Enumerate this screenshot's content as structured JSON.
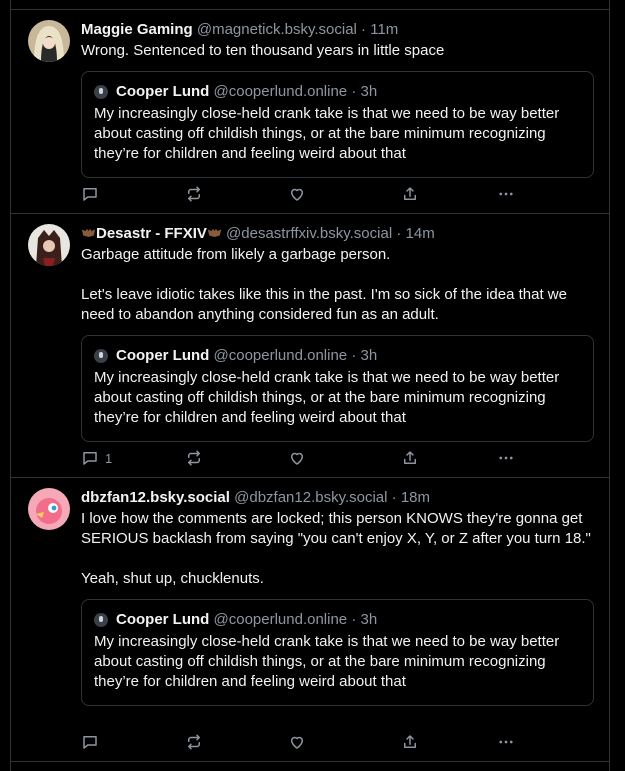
{
  "posts": [
    {
      "author": "Maggie Gaming",
      "handle": "@magnetick.bsky.social",
      "separator": "·",
      "time": "11m",
      "paragraphs": [
        "Wrong. Sentenced to ten thousand years in little space"
      ],
      "quote": {
        "author": "Cooper Lund",
        "handle": "@cooperlund.online",
        "separator": "·",
        "time": "3h",
        "text": "My increasingly close-held crank take is that we need to be way better about casting off childish things, or at the bare minimum recognizing they’re for children and feeling weird about that"
      },
      "reply_count": ""
    },
    {
      "author": "Desastr - FFXIV",
      "handle": "@desastrffxiv.bsky.social",
      "separator": "·",
      "time": "14m",
      "paragraphs": [
        "Garbage attitude from likely a garbage person.",
        "Let's leave idiotic takes like this in the past. I'm so sick of the idea that we need to abandon anything considered fun as an adult."
      ],
      "quote": {
        "author": "Cooper Lund",
        "handle": "@cooperlund.online",
        "separator": "·",
        "time": "3h",
        "text": "My increasingly close-held crank take is that we need to be way better about casting off childish things, or at the bare minimum recognizing they’re for children and feeling weird about that"
      },
      "reply_count": "1"
    },
    {
      "author": "dbzfan12.bsky.social",
      "handle": "@dbzfan12.bsky.social",
      "separator": "·",
      "time": "18m",
      "paragraphs": [
        "I love how the comments are locked; this person KNOWS they're gonna get SERIOUS backlash from saying \"you can't enjoy X, Y, or Z after you turn 18.\"",
        "Yeah, shut up, chucklenuts."
      ],
      "quote": {
        "author": "Cooper Lund",
        "handle": "@cooperlund.online",
        "separator": "·",
        "time": "3h",
        "text": "My increasingly close-held crank take is that we need to be way better about casting off childish things, or at the bare minimum recognizing they’re for children and feeling weird about that"
      },
      "reply_count": ""
    }
  ],
  "icons": {
    "reply": "reply-icon",
    "repost": "repost-icon",
    "like": "heart-icon",
    "share": "share-icon",
    "more": "more-icon"
  },
  "colors": {
    "background": "#000000",
    "border": "#2e3338",
    "text": "#f1f3f5",
    "muted": "#8d96a0"
  }
}
